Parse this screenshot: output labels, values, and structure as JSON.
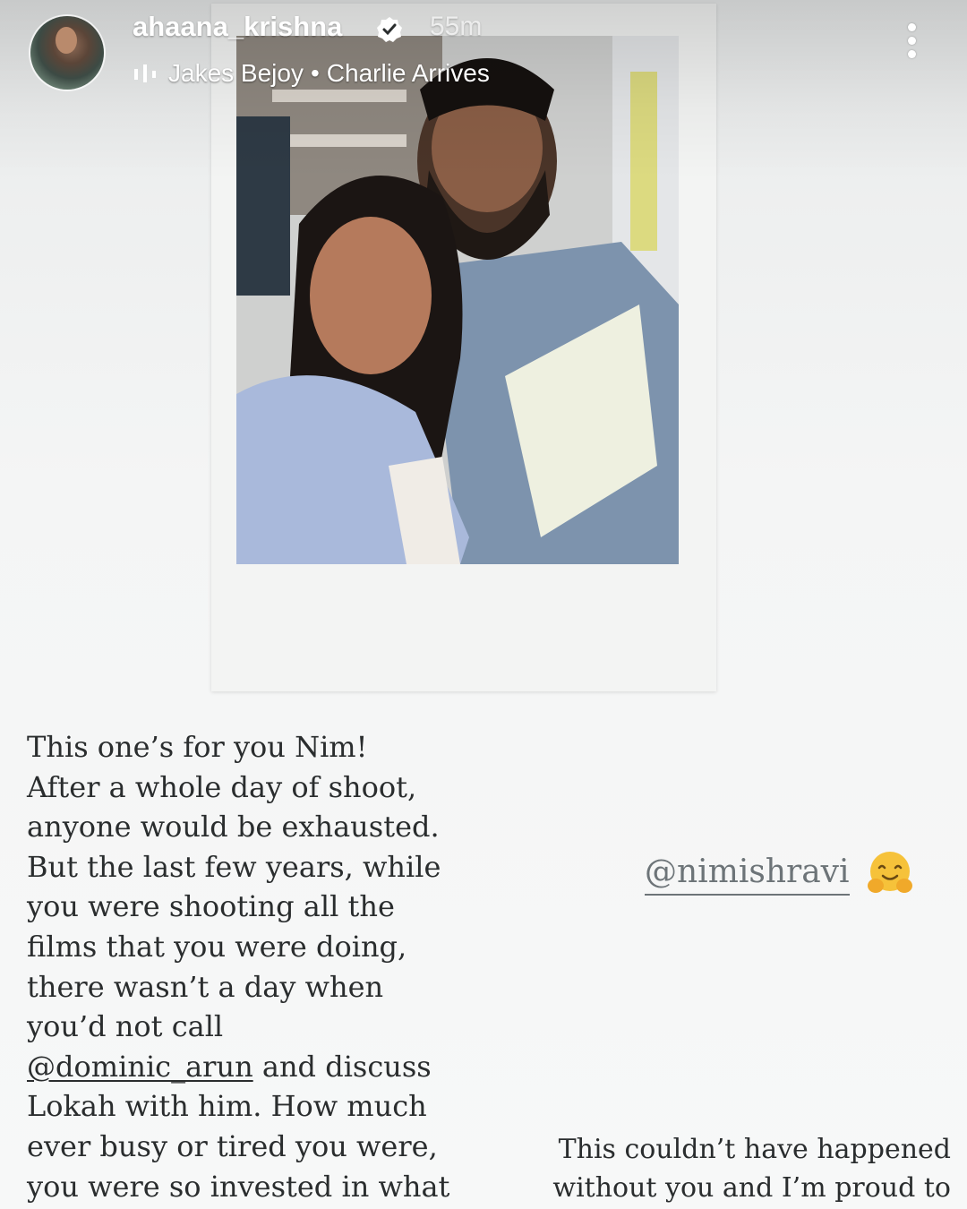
{
  "story": {
    "username": "ahaana_krishna",
    "time_ago": "55m",
    "music": {
      "artist": "Jakes Bejoy",
      "separator": "•",
      "track": "Charlie Arrives"
    }
  },
  "caption": {
    "lines": [
      "This one’s for you Nim!",
      "After a whole day of shoot,",
      "anyone would be exhausted.",
      "But the last few years, while",
      "you were shooting all the",
      "films that you were doing,",
      "there wasn’t a day when",
      "you’d not call"
    ],
    "mention_dominic": "@dominic_arun",
    "after_mention": " and discuss",
    "lines_after": [
      "Lokah with him. How much",
      "ever busy or tired you were,",
      "you were so invested in what"
    ]
  },
  "tag": {
    "mention": "@nimishravi",
    "emoji": "hugging-face-icon"
  },
  "caption_right": {
    "lines": [
      "This couldn’t have happened",
      "without you and I’m proud to"
    ]
  },
  "icons": {
    "verified": "verified-badge-icon",
    "music": "music-bars-icon",
    "more": "more-options-icon"
  }
}
